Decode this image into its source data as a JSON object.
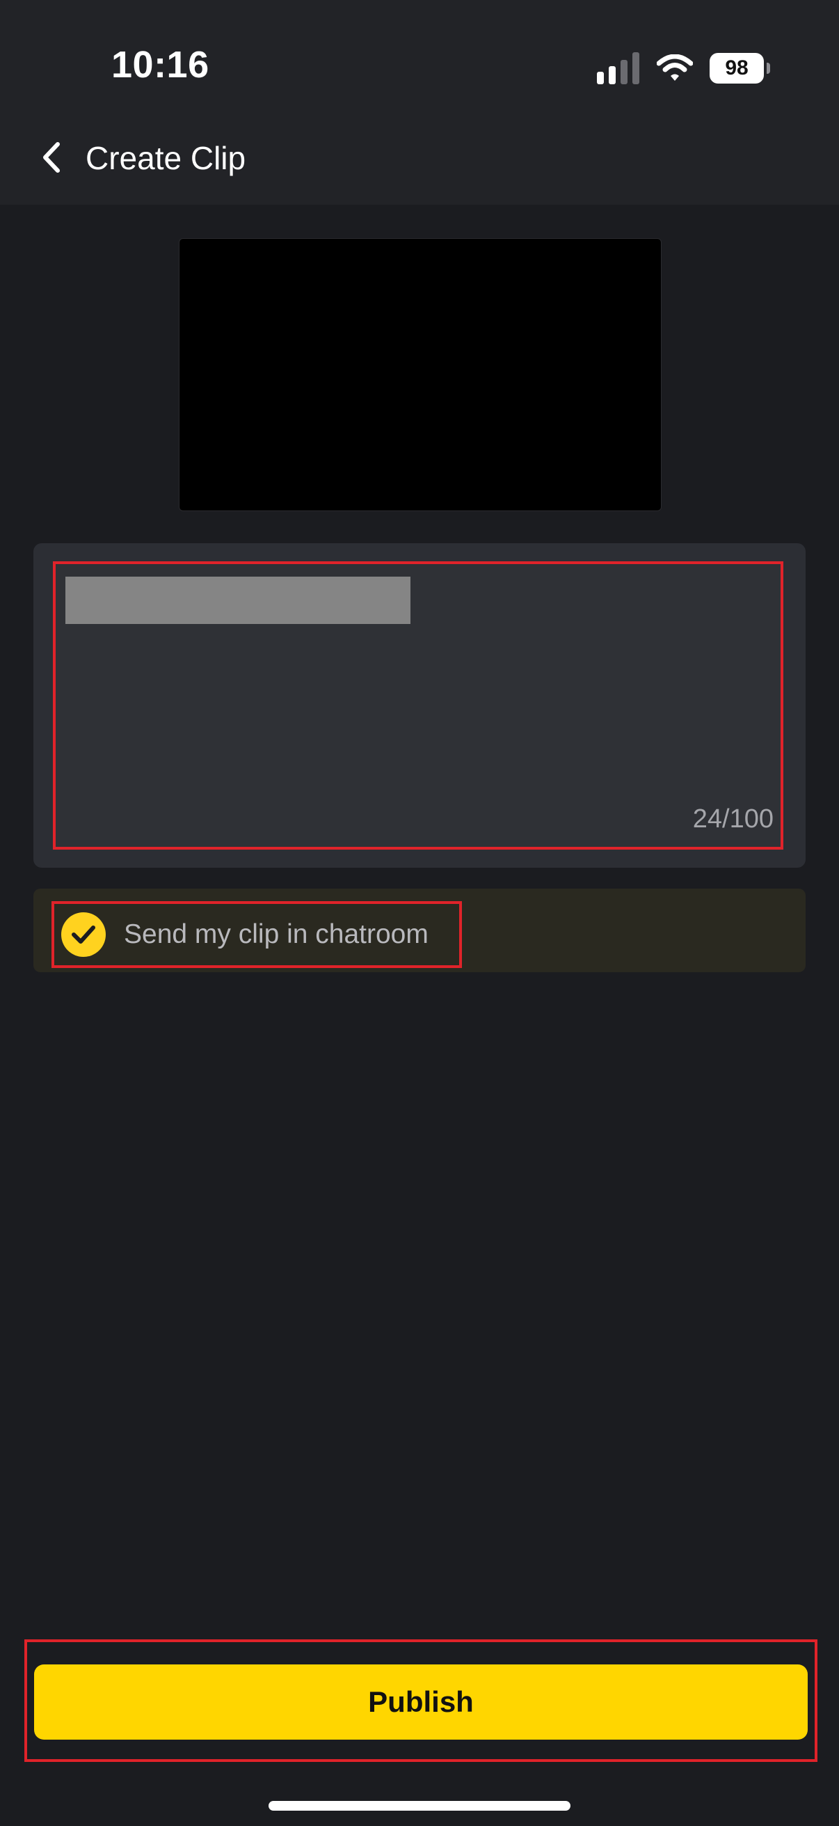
{
  "status_bar": {
    "time": "10:16",
    "battery": "98",
    "icons": [
      "cellular-signal-icon",
      "wifi-icon",
      "battery-icon"
    ]
  },
  "header": {
    "back_icon": "chevron-left-icon",
    "title": "Create Clip"
  },
  "clip_form": {
    "title_value": "",
    "char_count": "24/100"
  },
  "send_option": {
    "label": "Send my clip in chatroom",
    "checked": true,
    "icon": "checkmark-icon"
  },
  "publish": {
    "label": "Publish"
  },
  "colors": {
    "accent": "#ffd600",
    "background": "#1b1c20",
    "highlight_border": "#e0232a"
  }
}
